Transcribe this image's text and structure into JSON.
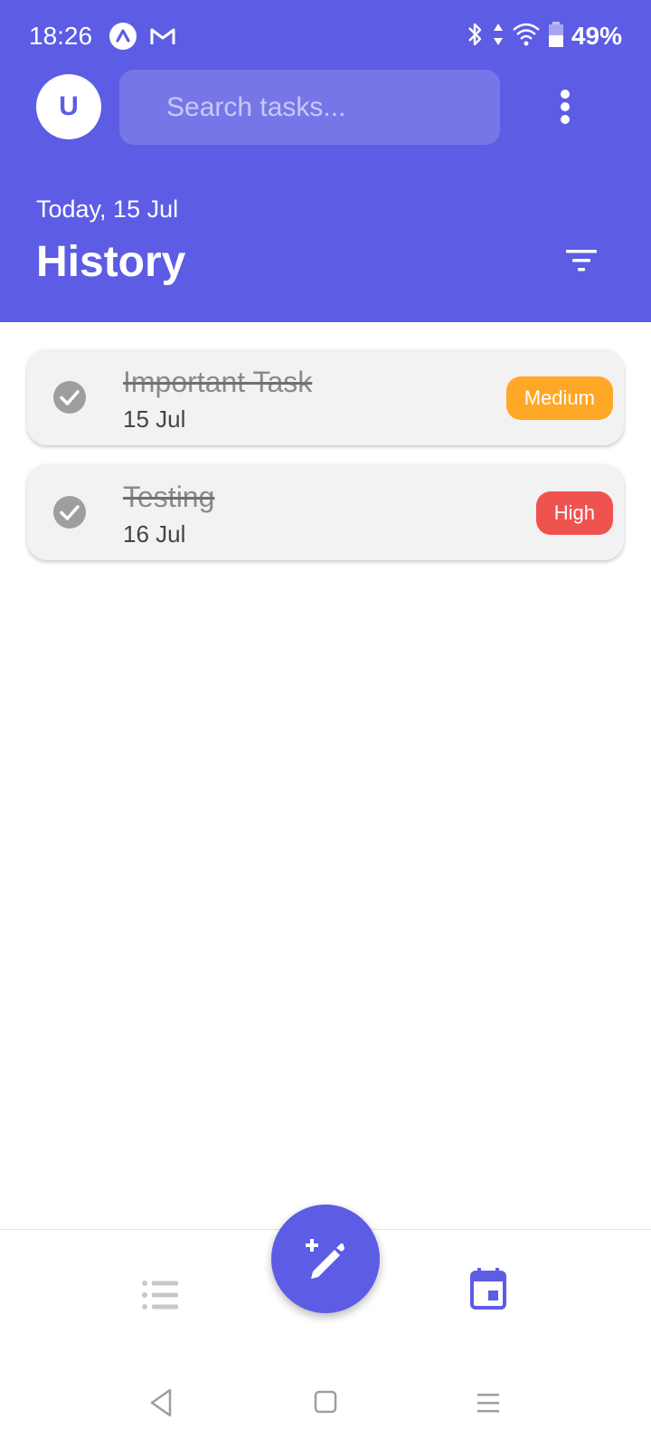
{
  "status_bar": {
    "time": "18:26",
    "notification_icons": [
      "app-a-icon",
      "gmail-icon"
    ],
    "system_icons": [
      "bluetooth-icon",
      "data-arrows-icon",
      "wifi-icon",
      "battery-icon"
    ],
    "battery_percent": "49%"
  },
  "header": {
    "avatar_initial": "U",
    "search_placeholder": "Search tasks...",
    "menu_icon": "more-vert-icon",
    "date_subtitle": "Today, 15 Jul",
    "title": "History",
    "filter_icon": "filter-icon"
  },
  "tasks": [
    {
      "title": "Important Task",
      "date": "15 Jul",
      "priority": "Medium",
      "priority_color": "#ffa726",
      "completed": true
    },
    {
      "title": "Testing",
      "date": "16 Jul",
      "priority": "High",
      "priority_color": "#ef5350",
      "completed": true
    }
  ],
  "bottom_nav": {
    "items": [
      {
        "icon": "list-icon",
        "active": false
      },
      {
        "icon": "calendar-icon",
        "active": true
      }
    ],
    "fab_icon": "edit-add-icon"
  },
  "system_nav": {
    "items": [
      "back-icon",
      "home-icon",
      "recents-icon"
    ]
  },
  "colors": {
    "primary": "#5d5ce5",
    "card_bg": "#f2f2f2",
    "inactive_icon": "#c8c8c8"
  }
}
